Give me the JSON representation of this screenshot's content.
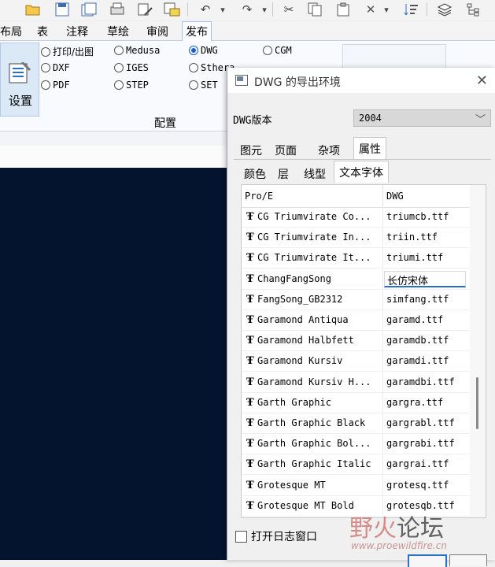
{
  "toolbar": {
    "icons": [
      "open-folder-icon",
      "save-icon",
      "save-copy-icon",
      "print-icon",
      "magic-icon",
      "export-icon",
      "undo-icon",
      "redo-icon",
      "cut-icon",
      "copy-icon",
      "paste-icon",
      "delete-icon",
      "sort-icon",
      "layers-icon",
      "tree-icon"
    ],
    "glyphs": {
      "undo": "↶",
      "redo": "↷",
      "cut": "✂",
      "delete": "✕",
      "dropdown": "▾"
    }
  },
  "ribbon_tabs": [
    "布局",
    "表",
    "注释",
    "草绘",
    "审阅",
    "发布"
  ],
  "active_ribbon_tab": "发布",
  "ribbon": {
    "setup_label": "设置",
    "group_label": "配置",
    "radios": [
      {
        "label": "打印/出图",
        "checked": false
      },
      {
        "label": "DXF",
        "checked": false
      },
      {
        "label": "PDF",
        "checked": false
      },
      {
        "label": "Medusa",
        "checked": false
      },
      {
        "label": "IGES",
        "checked": false
      },
      {
        "label": "STEP",
        "checked": false
      },
      {
        "label": "DWG",
        "checked": true
      },
      {
        "label": "Sthera",
        "checked": false
      },
      {
        "label": "SET",
        "checked": false
      },
      {
        "label": "CGM",
        "checked": false
      }
    ]
  },
  "dialog": {
    "title": "DWG 的导出环境",
    "close_glyph": "✕",
    "version_label": "DWG版本",
    "version_value": "2004",
    "chevron": "﹀",
    "tabs_row1": [
      "图元",
      "页面",
      "杂项",
      "属性"
    ],
    "tabs_row1_selected": "属性",
    "tabs_row2": [
      "颜色",
      "层",
      "线型",
      "文本字体"
    ],
    "tabs_row2_selected": "文本字体",
    "table": {
      "headers": [
        "Pro/E",
        "DWG"
      ],
      "font_glyph": "Ŧ",
      "rows": [
        {
          "proe": "CG Triumvirate Co...",
          "dwg": "triumcb.ttf",
          "editing": false
        },
        {
          "proe": "CG Triumvirate In...",
          "dwg": "triin.ttf",
          "editing": false
        },
        {
          "proe": "CG Triumvirate It...",
          "dwg": "triumi.ttf",
          "editing": false
        },
        {
          "proe": "ChangFangSong",
          "dwg": "长仿宋体",
          "editing": true
        },
        {
          "proe": "FangSong_GB2312",
          "dwg": "simfang.ttf",
          "editing": false
        },
        {
          "proe": "Garamond Antiqua",
          "dwg": "garamd.ttf",
          "editing": false
        },
        {
          "proe": "Garamond Halbfett",
          "dwg": "garamdb.ttf",
          "editing": false
        },
        {
          "proe": "Garamond Kursiv",
          "dwg": "garamdi.ttf",
          "editing": false
        },
        {
          "proe": "Garamond Kursiv H...",
          "dwg": "garamdbi.ttf",
          "editing": false
        },
        {
          "proe": "Garth Graphic",
          "dwg": "gargra.ttf",
          "editing": false
        },
        {
          "proe": "Garth Graphic Black",
          "dwg": "gargrabl.ttf",
          "editing": false
        },
        {
          "proe": "Garth Graphic Bol...",
          "dwg": "gargrabi.ttf",
          "editing": false
        },
        {
          "proe": "Garth Graphic Italic",
          "dwg": "gargrai.ttf",
          "editing": false
        },
        {
          "proe": "Grotesque MT",
          "dwg": "grotesq.ttf",
          "editing": false
        },
        {
          "proe": "Grotesque MT Bold",
          "dwg": "grotesqb.ttf",
          "editing": false
        }
      ]
    },
    "log_checkbox_label": "打开日志窗口",
    "log_checkbox_checked": false
  },
  "watermark": {
    "text1": "野火",
    "text2": "论坛",
    "url": "www.proewildfire.cn"
  }
}
